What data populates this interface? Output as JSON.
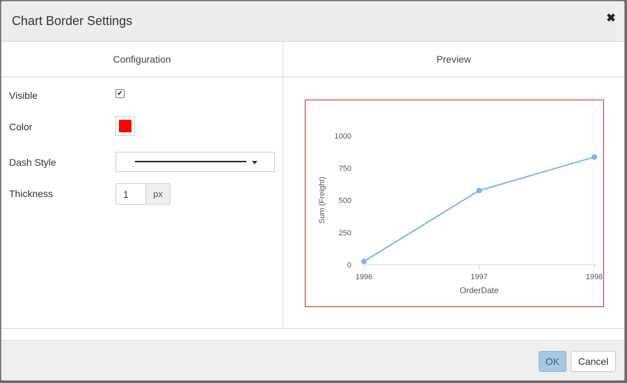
{
  "dialog": {
    "title": "Chart Border Settings",
    "close_glyph": "✖"
  },
  "configuration": {
    "header": "Configuration",
    "visible_label": "Visible",
    "visible_checked": true,
    "color_label": "Color",
    "color_value": "#ff0000",
    "dash_style_label": "Dash Style",
    "dash_style_value": "solid",
    "thickness_label": "Thickness",
    "thickness_value": "1",
    "thickness_unit": "px"
  },
  "preview": {
    "header": "Preview",
    "border_color": "#c0282d"
  },
  "chart_data": {
    "type": "line",
    "x": [
      "1996",
      "1997",
      "1998"
    ],
    "series": [
      {
        "values": [
          25,
          575,
          835
        ],
        "color": "#7cb5ec"
      }
    ],
    "xlabel": "OrderDate",
    "ylabel": "Sum (Freight)",
    "yticks": [
      "0",
      "250",
      "500",
      "750",
      "1000"
    ],
    "ylim": [
      0,
      1000
    ],
    "grid": false,
    "legend": "none"
  },
  "footer": {
    "ok_label": "OK",
    "cancel_label": "Cancel"
  }
}
